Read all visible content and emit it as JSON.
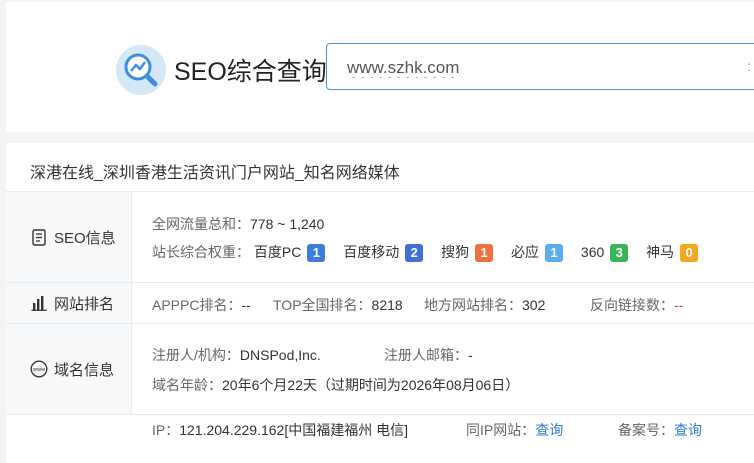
{
  "header": {
    "title": "SEO综合查询",
    "search_value": "www.szhk.com"
  },
  "site": {
    "title": "深港在线_深圳香港生活资讯门户网站_知名网络媒体"
  },
  "seo": {
    "label": "SEO信息",
    "traffic_key": "全网流量总和：",
    "traffic_value": "778 ~ 1,240",
    "weight_key": "站长综合权重：",
    "weights": [
      {
        "name": "百度PC",
        "value": "1",
        "color": "#3b7ddd"
      },
      {
        "name": "百度移动",
        "value": "2",
        "color": "#4170d8"
      },
      {
        "name": "搜狗",
        "value": "1",
        "color": "#f07040"
      },
      {
        "name": "必应",
        "value": "1",
        "color": "#5aaef0"
      },
      {
        "name": "360",
        "value": "3",
        "color": "#3cb55a"
      },
      {
        "name": "神马",
        "value": "0",
        "color": "#f5a623"
      }
    ]
  },
  "rank": {
    "label": "网站排名",
    "apppc_key": "APPPC排名：",
    "apppc_value": "--",
    "top_key": "TOP全国排名：",
    "top_value": "8218",
    "local_key": "地方网站排名：",
    "local_value": "302",
    "backlink_key": "反向链接数：",
    "backlink_value": "--"
  },
  "domain": {
    "label": "域名信息",
    "registrant_key": "注册人/机构：",
    "registrant_value": "DNSPod,Inc.",
    "email_key": "注册人邮箱：",
    "email_value": "-",
    "age_key": "域名年龄：",
    "age_value": "20年6个月22天（过期时间为2026年08月06日）"
  },
  "ip": {
    "ip_key": "IP：",
    "ip_value": "121.204.229.162[中国福建福州 电信]",
    "same_ip_key": "同IP网站：",
    "same_ip_link": "查询",
    "icp_key": "备案号：",
    "icp_link": "查询"
  }
}
